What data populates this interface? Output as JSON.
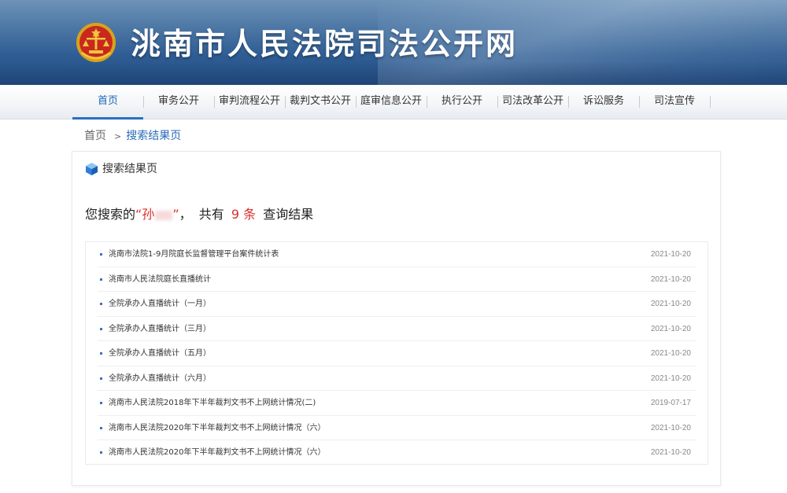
{
  "header": {
    "site_title": "洮南市人民法院司法公开网",
    "emblem_icon": "court-emblem-icon"
  },
  "nav": {
    "items": [
      {
        "label": "首页",
        "active": true
      },
      {
        "label": "审务公开",
        "active": false
      },
      {
        "label": "审判流程公开",
        "active": false
      },
      {
        "label": "裁判文书公开",
        "active": false
      },
      {
        "label": "庭审信息公开",
        "active": false
      },
      {
        "label": "执行公开",
        "active": false
      },
      {
        "label": "司法改革公开",
        "active": false
      },
      {
        "label": "诉讼服务",
        "active": false
      },
      {
        "label": "司法宣传",
        "active": false
      }
    ]
  },
  "breadcrumb": {
    "home": "首页",
    "separator": ">",
    "current": "搜索结果页"
  },
  "panel": {
    "title": "搜索结果页",
    "title_icon": "cube-icon",
    "summary": {
      "prefix": "您搜索的",
      "quote_open": "“",
      "keyword": "孙",
      "quote_close": "”",
      "comma": "，",
      "middle": "共有",
      "count": "9 条",
      "suffix": "查询结果"
    }
  },
  "results": [
    {
      "title": "洮南市法院1-9月院庭长监督管理平台案件统计表",
      "date": "2021-10-20"
    },
    {
      "title": "洮南市人民法院庭长直播统计",
      "date": "2021-10-20"
    },
    {
      "title": "全院承办人直播统计（一月）",
      "date": "2021-10-20"
    },
    {
      "title": "全院承办人直播统计（三月）",
      "date": "2021-10-20"
    },
    {
      "title": "全院承办人直播统计（五月）",
      "date": "2021-10-20"
    },
    {
      "title": "全院承办人直播统计（六月）",
      "date": "2021-10-20"
    },
    {
      "title": "洮南市人民法院2018年下半年裁判文书不上网统计情况(二)",
      "date": "2019-07-17"
    },
    {
      "title": "洮南市人民法院2020年下半年裁判文书不上网统计情况（六）",
      "date": "2021-10-20"
    },
    {
      "title": "洮南市人民法院2020年下半年裁判文书不上网统计情况（六）",
      "date": "2021-10-20"
    }
  ],
  "colors": {
    "accent": "#2b6fc2",
    "highlight": "#d9312b",
    "banner": "#2f5d93"
  }
}
